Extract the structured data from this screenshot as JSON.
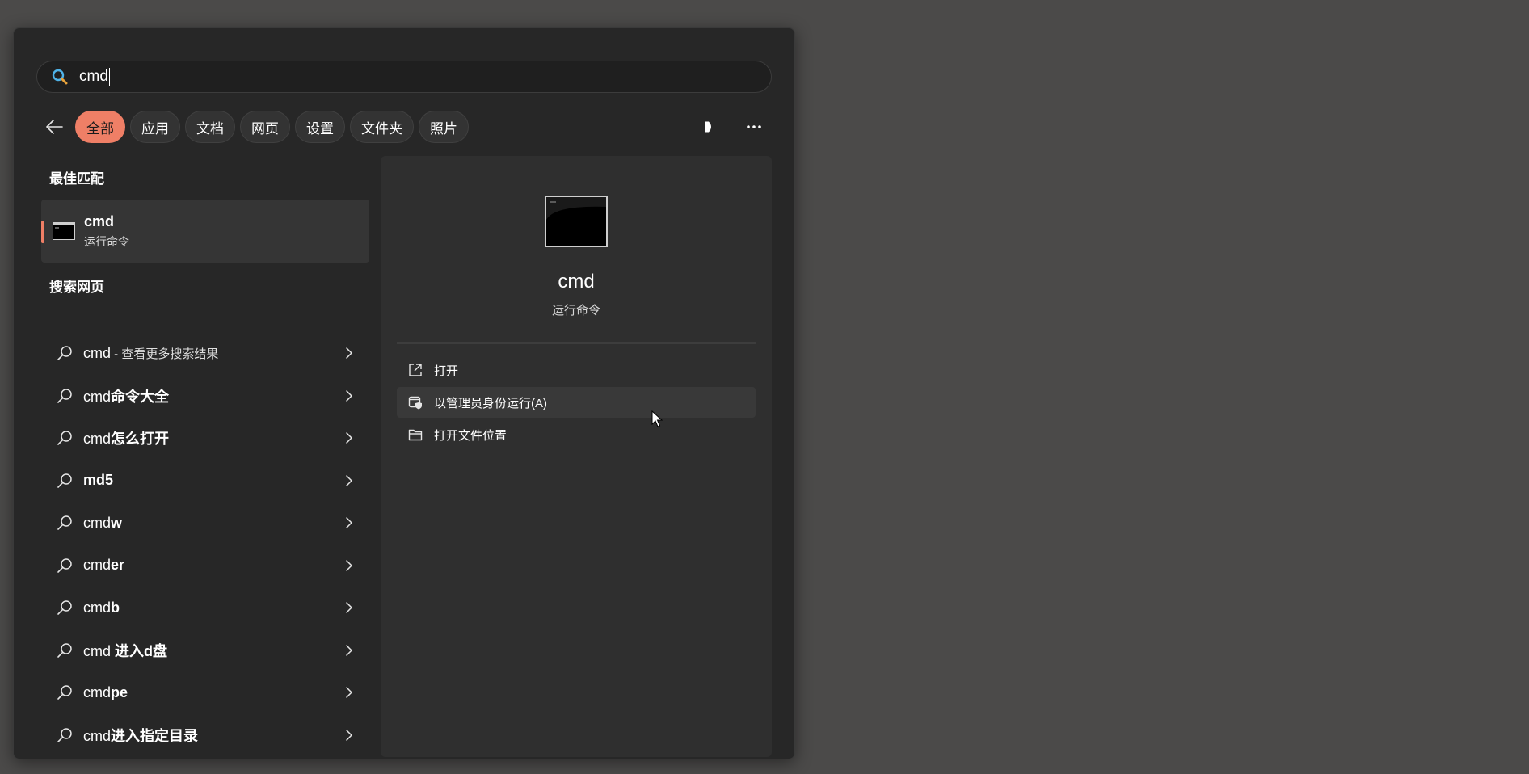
{
  "search": {
    "query": "cmd"
  },
  "filters": {
    "chips": [
      "全部",
      "应用",
      "文档",
      "网页",
      "设置",
      "文件夹",
      "照片"
    ],
    "active_index": 0
  },
  "best_match": {
    "section_title": "最佳匹配",
    "name": "cmd",
    "subtitle": "运行命令"
  },
  "web": {
    "section_title": "搜索网页",
    "items": [
      {
        "prefix": "cmd",
        "bold": "",
        "extra": " - 查看更多搜索结果"
      },
      {
        "prefix": "cmd",
        "bold": "命令大全",
        "extra": ""
      },
      {
        "prefix": "cmd",
        "bold": "怎么打开",
        "extra": ""
      },
      {
        "prefix": "",
        "bold": "md5",
        "extra": ""
      },
      {
        "prefix": "cmd",
        "bold": "w",
        "extra": ""
      },
      {
        "prefix": "cmd",
        "bold": "er",
        "extra": ""
      },
      {
        "prefix": "cmd",
        "bold": "b",
        "extra": ""
      },
      {
        "prefix": "cmd",
        "bold": " 进入d盘",
        "extra": ""
      },
      {
        "prefix": "cmd",
        "bold": "pe",
        "extra": ""
      },
      {
        "prefix": "cmd",
        "bold": "进入指定目录",
        "extra": ""
      }
    ]
  },
  "detail": {
    "name": "cmd",
    "subtitle": "运行命令",
    "actions": [
      {
        "label": "打开",
        "icon": "open-external-icon"
      },
      {
        "label": "以管理员身份运行(A)",
        "icon": "run-as-admin-icon"
      },
      {
        "label": "打开文件位置",
        "icon": "folder-icon"
      }
    ]
  },
  "colors": {
    "accent": "#ef7f66",
    "panel": "#272727",
    "desktop": "#4b4a49"
  }
}
